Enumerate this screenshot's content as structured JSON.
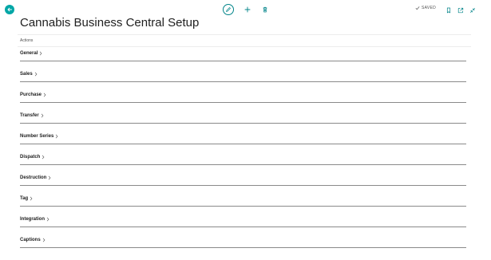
{
  "header": {
    "back_icon": "back-arrow-icon",
    "edit_icon": "pencil-icon",
    "new_icon": "plus-icon",
    "delete_icon": "trash-icon",
    "saved_label": "SAVED",
    "bookmark_icon": "bookmark-icon",
    "open_new_window_icon": "open-in-new-window-icon",
    "collapse_icon": "collapse-icon"
  },
  "page": {
    "title": "Cannabis Business Central Setup",
    "actions_label": "Actions"
  },
  "sections": [
    {
      "label": "General"
    },
    {
      "label": "Sales"
    },
    {
      "label": "Purchase"
    },
    {
      "label": "Transfer"
    },
    {
      "label": "Number Series"
    },
    {
      "label": "Dispatch"
    },
    {
      "label": "Destruction"
    },
    {
      "label": "Tag"
    },
    {
      "label": "Integration"
    },
    {
      "label": "Captions"
    }
  ],
  "colors": {
    "accent": "#00a6a6",
    "accent_dark": "#008489",
    "text": "#212121",
    "muted": "#505050",
    "divider": "#8a8a8a"
  }
}
